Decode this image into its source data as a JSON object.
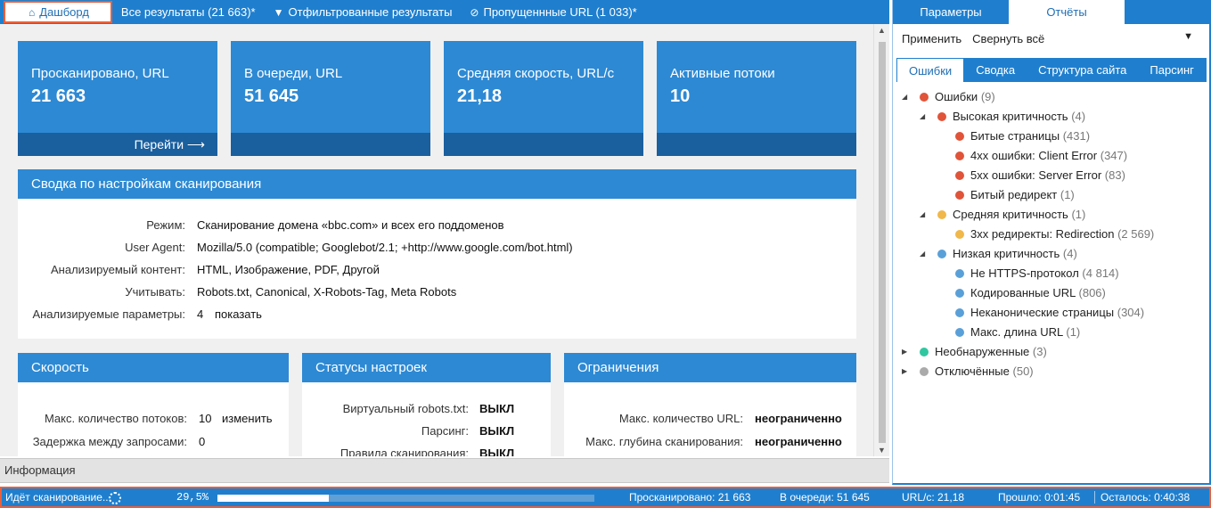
{
  "top_tabs": {
    "dashboard": "Дашборд",
    "all_results": "Все результаты (21 663)*",
    "filtered": "Отфильтрованные результаты",
    "skipped": "Пропущеннные URL (1 033)*"
  },
  "cards": [
    {
      "caption": "Просканировано, URL",
      "value": "21 663",
      "link": "Перейти ⟶"
    },
    {
      "caption": "В очереди, URL",
      "value": "51 645"
    },
    {
      "caption": "Средняя скорость, URL/с",
      "value": "21,18"
    },
    {
      "caption": "Активные потоки",
      "value": "10"
    }
  ],
  "summary": {
    "title": "Сводка по настройкам сканирования",
    "rows": [
      {
        "key": "Режим:",
        "value": "Сканирование домена «bbc.com» и всех его поддоменов"
      },
      {
        "key": "User Agent:",
        "value": "Mozilla/5.0 (compatible; Googlebot/2.1; +http://www.google.com/bot.html)"
      },
      {
        "key": "Анализируемый контент:",
        "value": "HTML, Изображение, PDF, Другой"
      },
      {
        "key": "Учитывать:",
        "value": "Robots.txt, Canonical, X-Robots-Tag, Meta Robots"
      },
      {
        "key": "Анализируемые параметры:",
        "value": "4",
        "link": "показать"
      }
    ]
  },
  "speed": {
    "title": "Скорость",
    "rows": [
      {
        "key": "Макс. количество потоков:",
        "value": "10",
        "link": "изменить"
      },
      {
        "key": "Задержка между запросами:",
        "value": "0"
      }
    ]
  },
  "settings_status": {
    "title": "Статусы настроек",
    "rows": [
      {
        "key": "Виртуальный robots.txt:",
        "value": "ВЫКЛ"
      },
      {
        "key": "Парсинг:",
        "value": "ВЫКЛ"
      },
      {
        "key": "Правила сканирования:",
        "value": "ВЫКЛ"
      }
    ]
  },
  "limits": {
    "title": "Ограничения",
    "rows": [
      {
        "key": "Макс. количество URL:",
        "value": "неограниченно"
      },
      {
        "key": "Макс. глубина сканирования:",
        "value": "неограниченно"
      }
    ]
  },
  "info_bar": "Информация",
  "right_panel": {
    "tabs": [
      "Параметры",
      "Отчёты"
    ],
    "toolbar": {
      "apply": "Применить",
      "collapse": "Свернуть всё"
    },
    "subtabs": [
      "Ошибки",
      "Сводка",
      "Структура сайта",
      "Парсинг"
    ],
    "tree": [
      {
        "label": "Ошибки",
        "count": "(9)",
        "level": 0,
        "color": "red",
        "toggle": "◢"
      },
      {
        "label": "Высокая критичность",
        "count": "(4)",
        "level": 1,
        "color": "red",
        "toggle": "◢"
      },
      {
        "label": "Битые страницы",
        "count": "(431)",
        "level": 2,
        "color": "red"
      },
      {
        "label": "4xx ошибки: Client Error",
        "count": "(347)",
        "level": 2,
        "color": "red"
      },
      {
        "label": "5xx ошибки: Server Error",
        "count": "(83)",
        "level": 2,
        "color": "red"
      },
      {
        "label": "Битый редирект",
        "count": "(1)",
        "level": 2,
        "color": "red"
      },
      {
        "label": "Средняя критичность",
        "count": "(1)",
        "level": 1,
        "color": "orange",
        "toggle": "◢"
      },
      {
        "label": "3xx редиректы: Redirection",
        "count": "(2 569)",
        "level": 2,
        "color": "orange"
      },
      {
        "label": "Низкая критичность",
        "count": "(4)",
        "level": 1,
        "color": "blue",
        "toggle": "◢"
      },
      {
        "label": "Не HTTPS-протокол",
        "count": "(4 814)",
        "level": 2,
        "color": "blue"
      },
      {
        "label": "Кодированные URL",
        "count": "(806)",
        "level": 2,
        "color": "blue"
      },
      {
        "label": "Неканонические страницы",
        "count": "(304)",
        "level": 2,
        "color": "blue"
      },
      {
        "label": "Макс. длина URL",
        "count": "(1)",
        "level": 2,
        "color": "blue"
      },
      {
        "label": "Необнаруженные",
        "count": "(3)",
        "level": 0,
        "color": "green",
        "toggle": "▶"
      },
      {
        "label": "Отключённые",
        "count": "(50)",
        "level": 0,
        "color": "gray",
        "toggle": "▶"
      }
    ]
  },
  "status_bar": {
    "scanning": "Идёт сканирование...",
    "percent": "29,5%",
    "progress": 0.295,
    "scanned": "Просканировано: 21 663",
    "queued": "В очереди: 51 645",
    "rate": "URL/с: 21,18",
    "elapsed": "Прошло: 0:01:45",
    "remaining": "Осталось: 0:40:38"
  }
}
